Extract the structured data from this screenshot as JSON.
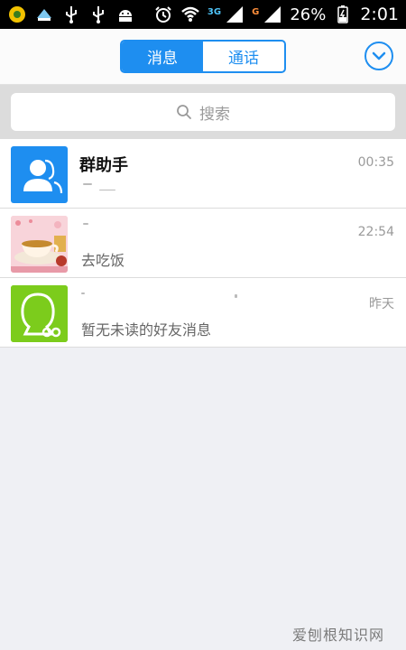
{
  "status_bar": {
    "net_3g": "3G",
    "net_g": "G",
    "battery": "26%",
    "time": "2:01"
  },
  "header": {
    "tabs": [
      {
        "label": "消息",
        "active": true
      },
      {
        "label": "通话",
        "active": false
      }
    ],
    "accent": "#1e8ef0"
  },
  "search": {
    "placeholder": "搜索"
  },
  "conversations": [
    {
      "title": "群助手",
      "message": "",
      "time": "00:35",
      "avatar": "group-assistant-icon",
      "avatar_color": "#1e8ef0"
    },
    {
      "title": "",
      "message": "去吃饭",
      "time": "22:54",
      "avatar": "tea-cup-photo"
    },
    {
      "title": "",
      "message": "暂无未读的好友消息",
      "time": "昨天",
      "avatar": "friend-silhouette-icon",
      "avatar_color": "#7ccc1c"
    }
  ],
  "watermark": "爱刨根知识网"
}
